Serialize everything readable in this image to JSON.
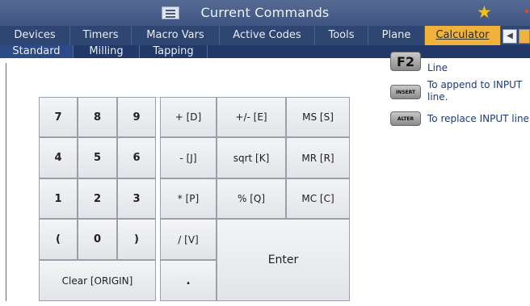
{
  "title_bar": {
    "title": "Current Commands",
    "menu_icon": "menu-icon",
    "status_icon": "star-icon"
  },
  "tabs": [
    {
      "label": "Devices"
    },
    {
      "label": "Timers"
    },
    {
      "label": "Macro Vars"
    },
    {
      "label": "Active Codes"
    },
    {
      "label": "Tools"
    },
    {
      "label": "Plane"
    },
    {
      "label": "Calculator",
      "active": true
    }
  ],
  "subtabs": [
    {
      "label": "Standard",
      "active": true
    },
    {
      "label": "Milling"
    },
    {
      "label": "Tapping"
    }
  ],
  "calculator": {
    "display_value": "",
    "keys": {
      "k7": "7",
      "k8": "8",
      "k9": "9",
      "k4": "4",
      "k5": "5",
      "k6": "6",
      "k1": "1",
      "k2": "2",
      "k3": "3",
      "lparen": "(",
      "k0": "0",
      "rparen": ")",
      "clear": "Clear [ORIGIN]",
      "add": "+ [D]",
      "negate": "+/- [E]",
      "ms": "MS [S]",
      "subtract": "- [J]",
      "sqrt": "sqrt [K]",
      "mr": "MR [R]",
      "multiply": "* [P]",
      "percent": "% [Q]",
      "mc": "MC [C]",
      "divide": "/ [V]",
      "enter": "Enter",
      "decimal": "."
    }
  },
  "help": {
    "f2_key": "F2",
    "f2_text": "Line",
    "insert_key": "INSERT",
    "insert_text": "To append to INPUT line.",
    "alter_key": "ALTER",
    "alter_text": "To replace INPUT line"
  },
  "colors": {
    "title_bar": "#4a5f8b",
    "tab_bar": "#2f4572",
    "active_tab": "#f0b23b",
    "help_text": "#1d3a78"
  }
}
